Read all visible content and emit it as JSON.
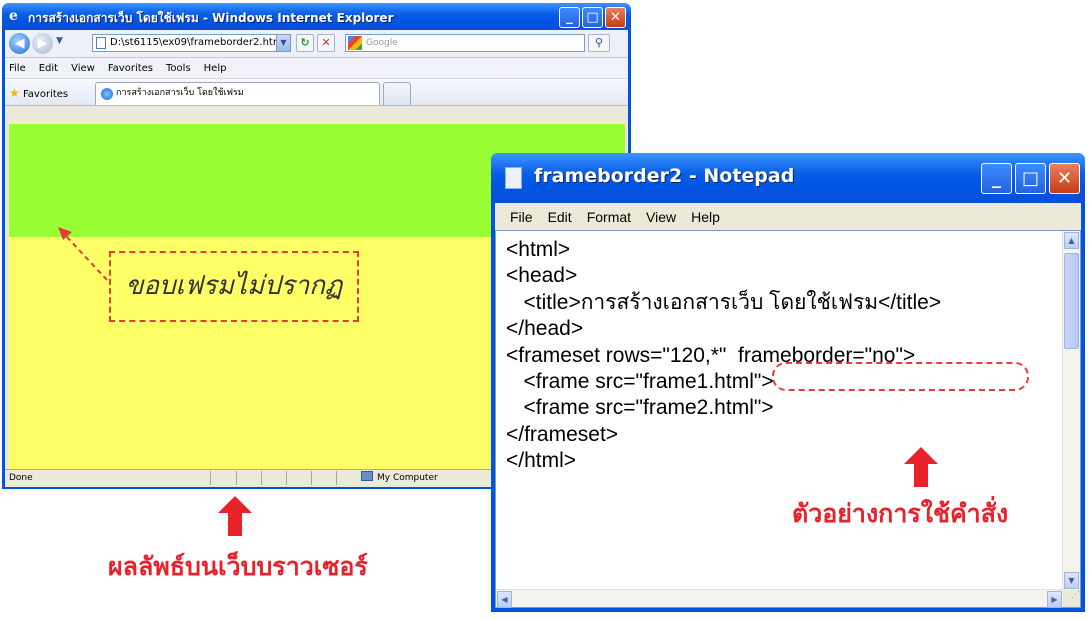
{
  "browser": {
    "title": "การสร้างเอกสารเว็บ โดยใช้เฟรม - Windows Internet Explorer",
    "address": "D:\\st6115\\ex09\\frameborder2.htm",
    "search_placeholder": "Google",
    "menu": [
      "File",
      "Edit",
      "View",
      "Favorites",
      "Tools",
      "Help"
    ],
    "favorites_label": "Favorites",
    "tab_label": "การสร้างเอกสารเว็บ โดยใช้เฟรม",
    "status_text": "Done",
    "status_zone": "My Computer",
    "frame_colors": {
      "top": "#99ff33",
      "bottom": "#ffff66"
    }
  },
  "annotations": {
    "browser_note": "ขอบเฟรมไม่ปรากฏ",
    "browser_caption": "ผลลัพธ์บนเว็บบราวเซอร์",
    "code_caption": "ตัวอย่างการใช้คำสั่ง",
    "accent_color": "#e8212b"
  },
  "notepad": {
    "title": "frameborder2 - Notepad",
    "menu": [
      "File",
      "Edit",
      "Format",
      "View",
      "Help"
    ],
    "lines": [
      "<html>",
      "<head>",
      "   <title>การสร้างเอกสารเว็บ โดยใช้เฟรม</title>",
      "</head>",
      "<frameset rows=\"120,*\"  frameborder=\"no\">",
      "   <frame src=\"frame1.html\">",
      "   <frame src=\"frame2.html\">",
      "</frameset>",
      "</html>"
    ]
  }
}
